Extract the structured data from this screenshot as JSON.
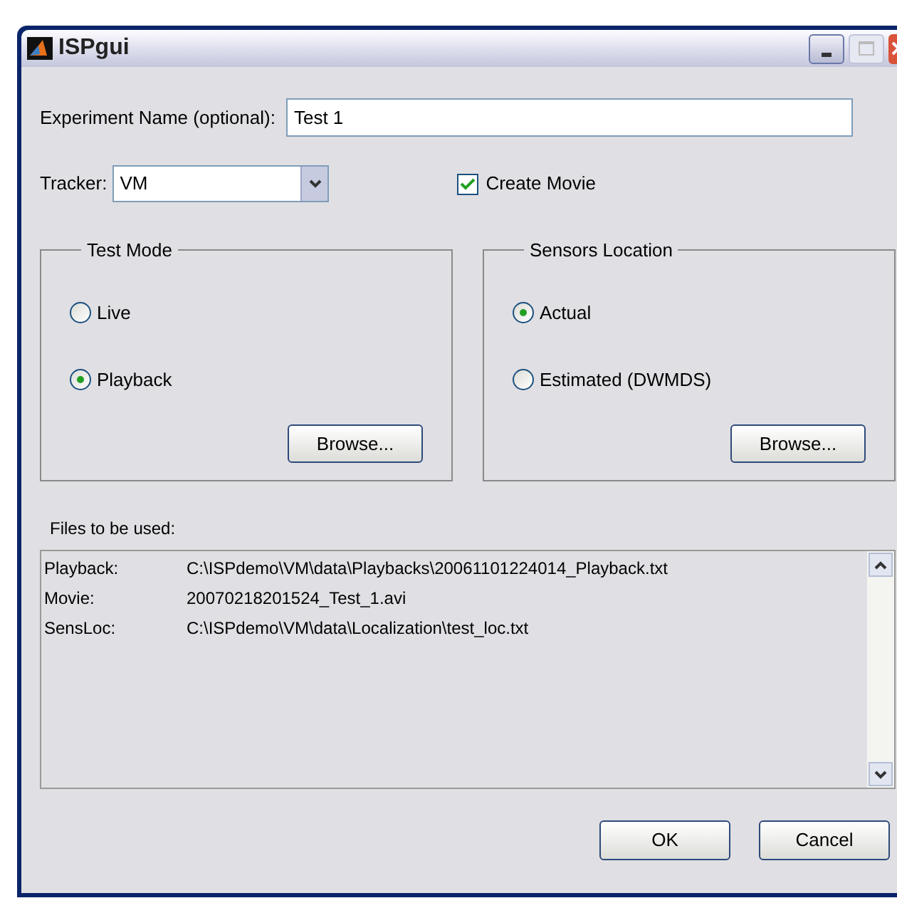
{
  "window": {
    "title": "ISPgui"
  },
  "experiment_name": {
    "label": "Experiment Name (optional):",
    "value": "Test 1"
  },
  "tracker": {
    "label": "Tracker:",
    "value": "VM"
  },
  "create_movie": {
    "label": "Create Movie",
    "checked": true
  },
  "test_mode": {
    "title": "Test Mode",
    "options": [
      {
        "label": "Live",
        "selected": false
      },
      {
        "label": "Playback",
        "selected": true
      }
    ],
    "button": "Browse..."
  },
  "sensors_location": {
    "title": "Sensors Location",
    "options": [
      {
        "label": "Actual",
        "selected": true
      },
      {
        "label": "Estimated (DWMDS)",
        "selected": false
      }
    ],
    "button": "Browse..."
  },
  "files": {
    "label": "Files to be used:",
    "rows": [
      {
        "key": "Playback:",
        "path": "C:\\ISPdemo\\VM\\data\\Playbacks\\20061101224014_Playback.txt"
      },
      {
        "key": "Movie:",
        "path": "20070218201524_Test_1.avi"
      },
      {
        "key": "SensLoc:",
        "path": "C:\\ISPdemo\\VM\\data\\Localization\\test_loc.txt"
      }
    ]
  },
  "buttons": [
    "OK",
    "Cancel"
  ]
}
